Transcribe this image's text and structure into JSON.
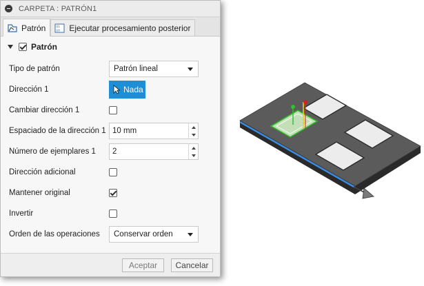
{
  "dialog": {
    "title": "CARPETA : PATRÓN1",
    "tabs": [
      {
        "label": "Patrón",
        "active": true,
        "icon": "pattern-icon"
      },
      {
        "label": "Ejecutar procesamiento posterior",
        "active": false,
        "icon": "post-process-icon"
      }
    ],
    "group": {
      "label": "Patrón",
      "checked": true
    },
    "fields": {
      "pattern_type": {
        "label": "Tipo de patrón",
        "value": "Patrón lineal"
      },
      "direction1": {
        "label": "Dirección 1",
        "button": "Nada"
      },
      "flip_direction1": {
        "label": "Cambiar dirección 1",
        "checked": false
      },
      "spacing1": {
        "label": "Espaciado de la dirección 1",
        "value": "10 mm"
      },
      "count1": {
        "label": "Número de ejemplares 1",
        "value": "2"
      },
      "extra_direction": {
        "label": "Dirección adicional",
        "checked": false
      },
      "keep_original": {
        "label": "Mantener original",
        "checked": true
      },
      "invert": {
        "label": "Invertir",
        "checked": false
      },
      "operation_order": {
        "label": "Orden de las operaciones",
        "value": "Conservar orden"
      }
    },
    "buttons": {
      "ok": "Aceptar",
      "cancel": "Cancelar"
    }
  },
  "colors": {
    "accent": "#1d8fd8",
    "part_top": "#5b5b5b",
    "edge_highlight": "#3a8fe8",
    "selection_green": "#33b52b"
  }
}
